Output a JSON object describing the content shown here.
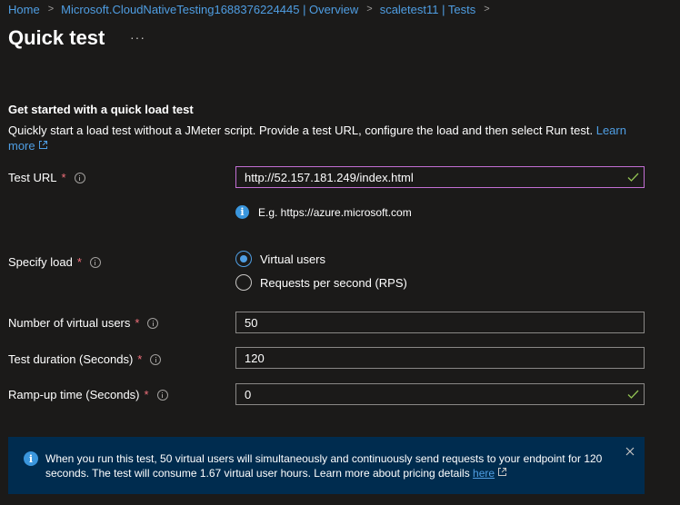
{
  "breadcrumb": {
    "items": [
      "Home",
      "Microsoft.CloudNativeTesting1688376224445 | Overview",
      "scaletest11 | Tests"
    ],
    "separator": ">"
  },
  "page": {
    "title": "Quick test",
    "more_label": "···"
  },
  "section": {
    "title": "Get started with a quick load test",
    "description": "Quickly start a load test without a JMeter script. Provide a test URL, configure the load and then select Run test.",
    "learn_more": "Learn more"
  },
  "form": {
    "test_url": {
      "label": "Test URL",
      "required": "*",
      "value": "http://52.157.181.249/index.html",
      "hint": "E.g. https://azure.microsoft.com"
    },
    "specify_load": {
      "label": "Specify load",
      "required": "*",
      "options": [
        "Virtual users",
        "Requests per second (RPS)"
      ],
      "selected": "Virtual users"
    },
    "virtual_users": {
      "label": "Number of virtual users",
      "required": "*",
      "value": "50"
    },
    "duration": {
      "label": "Test duration (Seconds)",
      "required": "*",
      "value": "120"
    },
    "ramp_up": {
      "label": "Ramp-up time (Seconds)",
      "required": "*",
      "value": "0"
    }
  },
  "banner": {
    "text": "When you run this test, 50 virtual users will simultaneously and continuously send requests to your endpoint for 120 seconds. The test will consume 1.67 virtual user hours. Learn more about pricing details",
    "link": "here"
  },
  "colors": {
    "background": "#1b1a19",
    "link": "#4f9ee3",
    "required": "#f1707b",
    "focus_border": "#c36fd4",
    "valid_check": "#92c353",
    "info_banner": "#002c4f"
  }
}
